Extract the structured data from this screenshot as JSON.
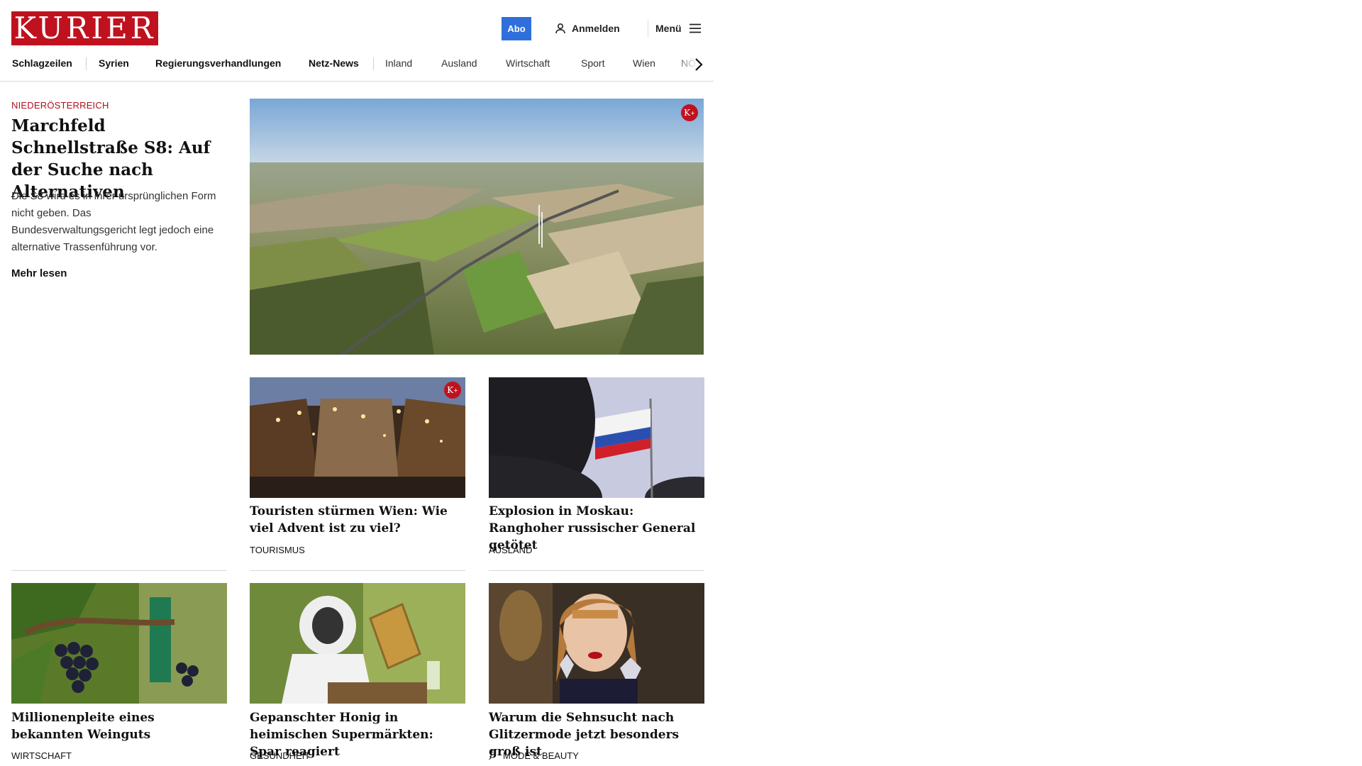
{
  "header": {
    "logo_text": "KURIER",
    "abo_label": "Abo",
    "login_label": "Anmelden",
    "menu_label": "Menü",
    "brand_color": "#c0111f",
    "abo_color": "#2f6fdb"
  },
  "nav": {
    "items": [
      "Schlagzeilen",
      "Syrien",
      "Regierungsverhandlungen",
      "Netz-News",
      "Inland",
      "Ausland",
      "Wirtschaft",
      "Sport",
      "Wien",
      "NÖ"
    ]
  },
  "hero": {
    "kicker": "NIEDERÖSTERREICH",
    "title": "Marchfeld Schnellstraße S8: Auf der Suche nach Alternativen",
    "text": "Die S8 wird es in ihrer ursprünglichen Form nicht geben. Das Bundesverwaltungsgericht legt jedoch eine alternative Trassenführung vor.",
    "more_label": "Mehr lesen",
    "image_desc_icon": "kplus-badge-icon"
  },
  "cards": [
    {
      "title": "Touristen stürmen Wien: Wie viel Advent ist zu viel?",
      "category": "TOURISMUS",
      "premium": true
    },
    {
      "title": "Explosion in Moskau: Ranghoher russischer General getötet",
      "category": "AUSLAND",
      "premium": false
    },
    {
      "title": "Millionenpleite eines bekannten Weinguts",
      "category": "WIRTSCHAFT",
      "premium": false
    },
    {
      "title": "Gepanschter Honig in heimischen Supermärkten: Spar reagiert",
      "category": "GESUNDHEIT",
      "premium": false
    },
    {
      "title": "Warum die Sehnsucht nach Glit­zermode jetzt besonders groß ist",
      "category": "MODE & BEAUTY",
      "premium": false,
      "freizeit_icon": "f."
    }
  ]
}
